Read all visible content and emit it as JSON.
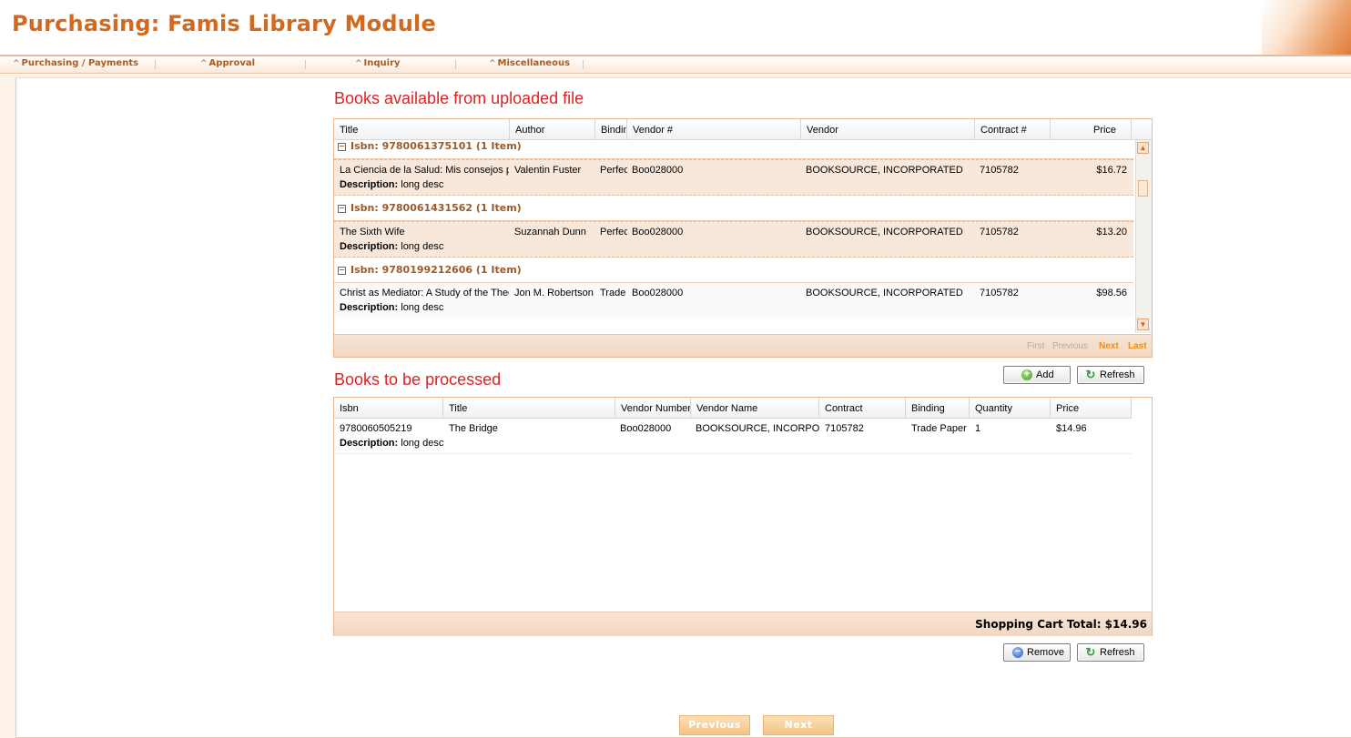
{
  "app": {
    "title": "Purchasing: Famis Library Module"
  },
  "nav": {
    "items": [
      {
        "label": "Purchasing / Payments"
      },
      {
        "label": "Approval"
      },
      {
        "label": "Inquiry"
      },
      {
        "label": "Miscellaneous"
      }
    ]
  },
  "available": {
    "title": "Books available from uploaded file",
    "columns": [
      "Title",
      "Author",
      "Bindin",
      "Vendor #",
      "Vendor",
      "Contract #",
      "Price"
    ],
    "groups": [
      {
        "header": "Isbn: 9780061375101 (1 Item)",
        "row": {
          "title": "La Ciencia de la Salud: Mis consejos pa",
          "author": "Valentin Fuster",
          "binding": "Perfec",
          "vendor_no": "Boo028000",
          "vendor": "BOOKSOURCE, INCORPORATED",
          "contract": "7105782",
          "price": "$16.72",
          "desc_label": "Description:",
          "desc": "long desc"
        }
      },
      {
        "header": "Isbn: 9780061431562 (1 Item)",
        "row": {
          "title": "The Sixth Wife",
          "author": "Suzannah Dunn",
          "binding": "Perfec",
          "vendor_no": "Boo028000",
          "vendor": "BOOKSOURCE, INCORPORATED",
          "contract": "7105782",
          "price": "$13.20",
          "desc_label": "Description:",
          "desc": "long desc"
        }
      },
      {
        "header": "Isbn: 9780199212606 (1 Item)",
        "row": {
          "title": "Christ as Mediator: A Study of the Theo",
          "author": "Jon M. Robertson",
          "binding": "Trade",
          "vendor_no": "Boo028000",
          "vendor": "BOOKSOURCE, INCORPORATED",
          "contract": "7105782",
          "price": "$98.56",
          "desc_label": "Description:",
          "desc": "long desc"
        }
      }
    ],
    "pager": {
      "first": "First",
      "previous": "Previous",
      "next": "Next",
      "last": "Last"
    },
    "buttons": {
      "add": "Add",
      "refresh": "Refresh"
    }
  },
  "processed": {
    "title": "Books to be processed",
    "columns": [
      "Isbn",
      "Title",
      "Vendor Number",
      "Vendor Name",
      "Contract",
      "Binding",
      "Quantity",
      "Price"
    ],
    "rows": [
      {
        "isbn": "9780060505219",
        "title": "The Bridge",
        "vendor_no": "Boo028000",
        "vendor": "BOOKSOURCE, INCORPORA",
        "contract": "7105782",
        "binding": "Trade Paper",
        "quantity": "1",
        "price": "$14.96",
        "desc_label": "Description:",
        "desc": "long desc"
      }
    ],
    "total": "Shopping Cart Total: $14.96",
    "buttons": {
      "remove": "Remove",
      "refresh": "Refresh"
    }
  },
  "wizard": {
    "previous": "Previous",
    "next": "Next"
  }
}
